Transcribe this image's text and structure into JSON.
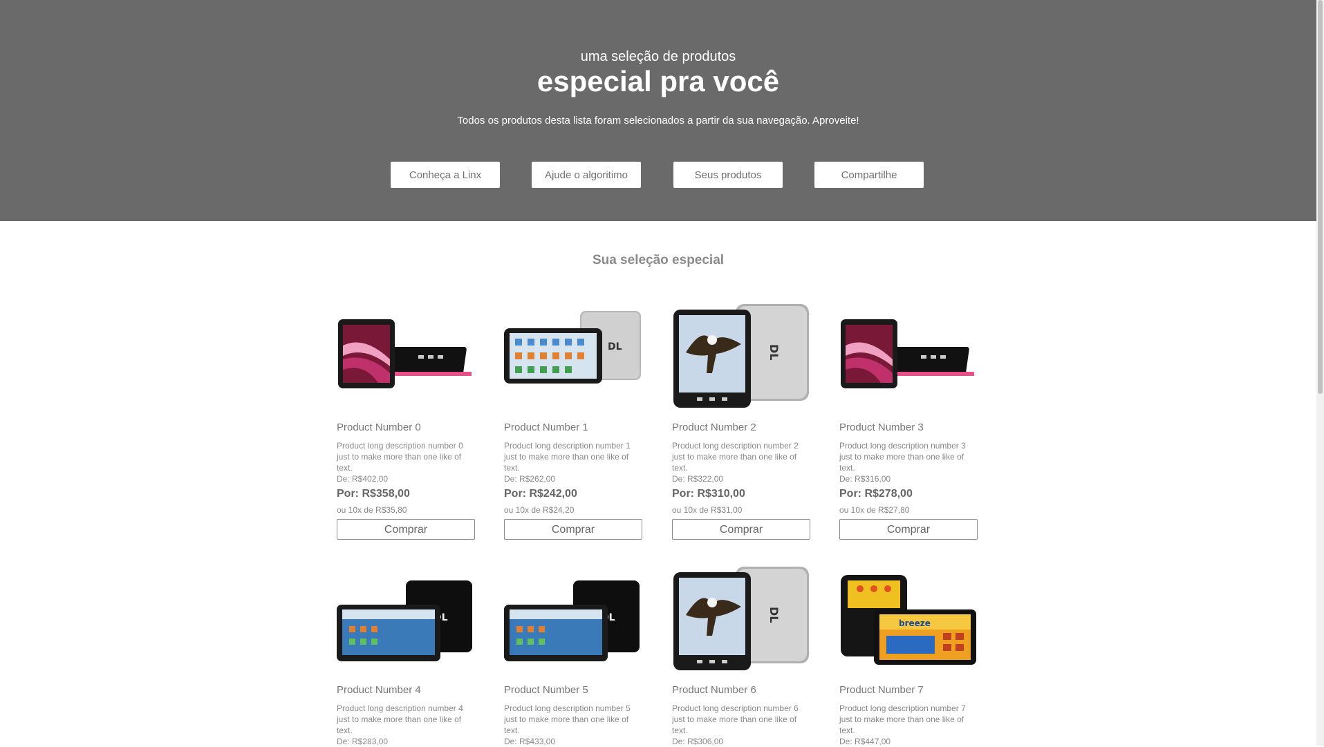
{
  "hero": {
    "subtitle": "uma seleção de produtos",
    "title": "especial pra você",
    "description": "Todos os produtos desta lista foram selecionados a partir da sua navegação. Aproveite!",
    "buttons": [
      "Conheça a Linx",
      "Ajude o algoritimo",
      "Seus produtos",
      "Compartilhe"
    ]
  },
  "section": {
    "title": "Sua seleção especial"
  },
  "products": [
    {
      "name": "Product Number 0",
      "description": "Product long description number 0 just to make more than one like of text.",
      "price_from": "De: R$402,00",
      "price_to": "Por: R$358,00",
      "installments": "ou 10x de R$35,80",
      "buy_label": "Comprar",
      "image": "pink-tablet"
    },
    {
      "name": "Product Number 1",
      "description": "Product long description number 1 just to make more than one like of text.",
      "price_from": "De: R$262,00",
      "price_to": "Por: R$242,00",
      "installments": "ou 10x de R$24,20",
      "buy_label": "Comprar",
      "image": "silver-widescreen-tablet"
    },
    {
      "name": "Product Number 2",
      "description": "Product long description number 2 just to make more than one like of text.",
      "price_from": "De: R$322,00",
      "price_to": "Por: R$310,00",
      "installments": "ou 10x de R$31,00",
      "buy_label": "Comprar",
      "image": "eagle-tablet"
    },
    {
      "name": "Product Number 3",
      "description": "Product long description number 3 just to make more than one like of text.",
      "price_from": "De: R$316,00",
      "price_to": "Por: R$278,00",
      "installments": "ou 10x de R$27,80",
      "buy_label": "Comprar",
      "image": "pink-tablet"
    },
    {
      "name": "Product Number 4",
      "description": "Product long description number 4 just to make more than one like of text.",
      "price_from": "De: R$283,00",
      "image": "black-widescreen-tablet"
    },
    {
      "name": "Product Number 5",
      "description": "Product long description number 5 just to make more than one like of text.",
      "price_from": "De: R$433,00",
      "image": "black-widescreen-tablet"
    },
    {
      "name": "Product Number 6",
      "description": "Product long description number 6 just to make more than one like of text.",
      "price_from": "De: R$306,00",
      "image": "eagle-tablet"
    },
    {
      "name": "Product Number 7",
      "description": "Product long description number 7 just to make more than one like of text.",
      "price_from": "De: R$447,00",
      "image": "tablet-with-case"
    }
  ],
  "colors": {
    "hero_bg": "#6a6a6a",
    "accent_pink": "#e8508a"
  }
}
